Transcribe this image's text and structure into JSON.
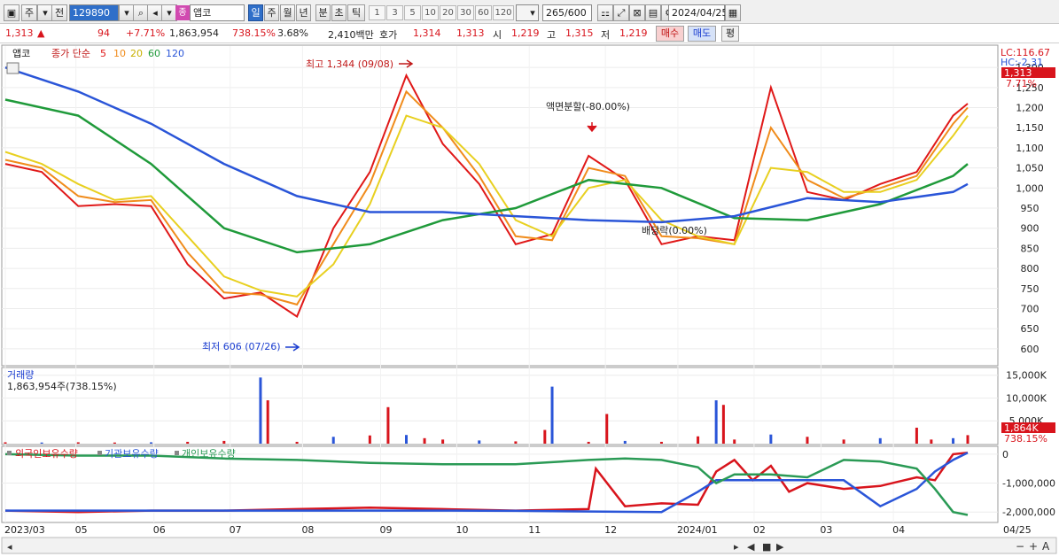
{
  "toolbar": {
    "period_buttons": [
      "주",
      "전"
    ],
    "code": "129890",
    "name_badge": "종",
    "name": "앱코",
    "timeframes": [
      "일",
      "주",
      "월",
      "년",
      "분",
      "초",
      "틱"
    ],
    "minute_units": [
      "1",
      "3",
      "5",
      "10",
      "20",
      "30",
      "60",
      "120"
    ],
    "count": "265",
    "count_total": "/600",
    "date": "2024/04/25"
  },
  "quote": {
    "price": "1,313",
    "arrow": "▲",
    "change": "94",
    "change_pct": "+7.71%",
    "volume": "1,863,954",
    "volume_ratio": "738.15%",
    "turnover": "3.68%",
    "amount": "2,410백만",
    "ask_label": "호가",
    "ask1": "1,314",
    "ask2": "1,313",
    "open_label": "시",
    "open": "1,219",
    "high_label": "고",
    "high": "1,315",
    "low_label": "저",
    "low": "1,219",
    "buy": "매수",
    "sell": "매도",
    "eval": "평"
  },
  "price_panel": {
    "name": "앱코",
    "ma_label": "종가 단순",
    "ma_periods": [
      "5",
      "10",
      "20",
      "60",
      "120"
    ],
    "ma_colors": [
      "#e01818",
      "#f08c1c",
      "#e8d020",
      "#1f9a3a",
      "#2a55d8"
    ],
    "lc": "LC:116.67",
    "hc": "HC:-2.31",
    "price_tag": "1,313",
    "pct_tag": "7.71%",
    "high_note": "최고 1,344 (09/08)",
    "low_note": "최저 606 (07/26)",
    "split_note": "액면분할(-80.00%)",
    "dividend_note": "배당락(0.00%)"
  },
  "volume_panel": {
    "title": "거래량",
    "summary": "1,863,954주(738.15%)",
    "tag1": "1,864K",
    "tag2": "738.15%"
  },
  "holdings_panel": {
    "series": [
      "외국인보유수량",
      "기관보유수량",
      "개인보유수량"
    ],
    "colors": [
      "#d8141c",
      "#2a55d8",
      "#2a9a55"
    ]
  },
  "x_axis": [
    "2023/03",
    "05",
    "06",
    "07",
    "08",
    "09",
    "10",
    "11",
    "12",
    "2024/01",
    "02",
    "03",
    "04",
    "04/25"
  ],
  "chart_data": [
    {
      "type": "line",
      "panel": "price",
      "y_ticks": [
        600,
        650,
        700,
        750,
        800,
        850,
        900,
        950,
        1000,
        1050,
        1100,
        1150,
        1200,
        1250,
        1300
      ],
      "ylim": [
        560,
        1340
      ],
      "x_labels": [
        "2023/03",
        "05",
        "06",
        "07",
        "08",
        "09",
        "10",
        "11",
        "12",
        "2024/01",
        "02",
        "03",
        "04"
      ],
      "series": [
        {
          "name": "5",
          "x": [
            0,
            10,
            20,
            30,
            40,
            50,
            60,
            70,
            80,
            90,
            100,
            110,
            120,
            130,
            140,
            150,
            160,
            170,
            180,
            190,
            200,
            210,
            220,
            230,
            240,
            250,
            260,
            264
          ],
          "values": [
            1060,
            1040,
            955,
            960,
            955,
            810,
            725,
            740,
            680,
            900,
            1040,
            1280,
            1110,
            1010,
            860,
            885,
            1080,
            1020,
            860,
            880,
            870,
            1250,
            990,
            970,
            1010,
            1040,
            1180,
            1210
          ]
        },
        {
          "name": "10",
          "x": [
            0,
            10,
            20,
            30,
            40,
            50,
            60,
            70,
            80,
            90,
            100,
            110,
            120,
            130,
            140,
            150,
            160,
            170,
            180,
            190,
            200,
            210,
            220,
            230,
            240,
            250,
            260,
            264
          ],
          "values": [
            1070,
            1050,
            980,
            965,
            970,
            840,
            740,
            735,
            710,
            860,
            1010,
            1240,
            1150,
            1030,
            880,
            870,
            1050,
            1030,
            880,
            875,
            860,
            1150,
            1020,
            975,
            1000,
            1030,
            1160,
            1200
          ]
        },
        {
          "name": "20",
          "x": [
            0,
            10,
            20,
            30,
            40,
            50,
            60,
            70,
            80,
            90,
            100,
            110,
            120,
            130,
            140,
            150,
            160,
            170,
            180,
            190,
            200,
            210,
            220,
            230,
            240,
            250,
            260,
            264
          ],
          "values": [
            1090,
            1060,
            1010,
            970,
            980,
            880,
            780,
            745,
            730,
            810,
            960,
            1180,
            1150,
            1060,
            920,
            880,
            1000,
            1020,
            920,
            880,
            860,
            1050,
            1040,
            990,
            990,
            1020,
            1130,
            1180
          ]
        },
        {
          "name": "60",
          "x": [
            0,
            20,
            40,
            60,
            80,
            100,
            120,
            140,
            160,
            180,
            200,
            220,
            240,
            260,
            264
          ],
          "values": [
            1220,
            1180,
            1060,
            900,
            840,
            860,
            920,
            950,
            1020,
            1000,
            925,
            920,
            960,
            1030,
            1060
          ]
        },
        {
          "name": "120",
          "x": [
            0,
            20,
            40,
            60,
            80,
            100,
            120,
            140,
            160,
            180,
            200,
            220,
            240,
            260,
            264
          ],
          "values": [
            1300,
            1240,
            1160,
            1060,
            980,
            940,
            940,
            930,
            920,
            915,
            930,
            975,
            965,
            990,
            1010
          ]
        }
      ]
    },
    {
      "type": "bar",
      "panel": "volume",
      "y_ticks": [
        "15,000K",
        "10,000K",
        "5,000K"
      ],
      "ylim": [
        0,
        16500
      ],
      "x": [
        0,
        10,
        20,
        30,
        40,
        50,
        60,
        70,
        72,
        80,
        90,
        100,
        105,
        110,
        115,
        120,
        130,
        140,
        148,
        150,
        160,
        165,
        170,
        180,
        190,
        195,
        197,
        200,
        210,
        220,
        230,
        240,
        250,
        254,
        260,
        264
      ],
      "values": [
        300,
        250,
        300,
        250,
        300,
        400,
        600,
        14500,
        9500,
        400,
        1500,
        1800,
        8000,
        1900,
        1200,
        900,
        700,
        500,
        3000,
        12500,
        400,
        6500,
        600,
        400,
        1600,
        9500,
        8500,
        900,
        2000,
        1500,
        900,
        1200,
        3500,
        900,
        1200,
        1864
      ]
    },
    {
      "type": "line",
      "panel": "holdings",
      "y_ticks": [
        "0",
        "-1,000,000",
        "-2,000,000"
      ],
      "ylim": [
        -2300000,
        150000
      ],
      "series": [
        {
          "name": "외국인보유수량",
          "x": [
            0,
            20,
            40,
            60,
            80,
            100,
            120,
            140,
            160,
            162,
            170,
            180,
            190,
            195,
            200,
            205,
            210,
            215,
            220,
            230,
            240,
            250,
            255,
            260,
            264
          ],
          "values": [
            -1950000,
            -2000000,
            -1950000,
            -1950000,
            -1900000,
            -1850000,
            -1900000,
            -1950000,
            -1900000,
            -500000,
            -1800000,
            -1700000,
            -1750000,
            -600000,
            -200000,
            -900000,
            -400000,
            -1300000,
            -1000000,
            -1200000,
            -1100000,
            -800000,
            -900000,
            0,
            50000
          ]
        },
        {
          "name": "기관보유수량",
          "x": [
            0,
            20,
            40,
            60,
            80,
            100,
            120,
            140,
            160,
            180,
            190,
            195,
            200,
            230,
            240,
            250,
            255,
            260,
            264
          ],
          "values": [
            -1950000,
            -1950000,
            -1950000,
            -1950000,
            -1950000,
            -1950000,
            -1950000,
            -1960000,
            -1980000,
            -2000000,
            -1300000,
            -900000,
            -900000,
            -900000,
            -1800000,
            -1200000,
            -600000,
            -200000,
            50000
          ]
        },
        {
          "name": "개인보유수량",
          "x": [
            0,
            20,
            40,
            60,
            80,
            100,
            120,
            140,
            160,
            170,
            180,
            190,
            195,
            200,
            210,
            220,
            230,
            240,
            250,
            255,
            260,
            264
          ],
          "values": [
            0,
            -50000,
            -50000,
            -150000,
            -200000,
            -300000,
            -350000,
            -350000,
            -200000,
            -150000,
            -200000,
            -450000,
            -1000000,
            -700000,
            -700000,
            -800000,
            -200000,
            -250000,
            -500000,
            -1200000,
            -2000000,
            -2100000
          ]
        }
      ]
    }
  ]
}
